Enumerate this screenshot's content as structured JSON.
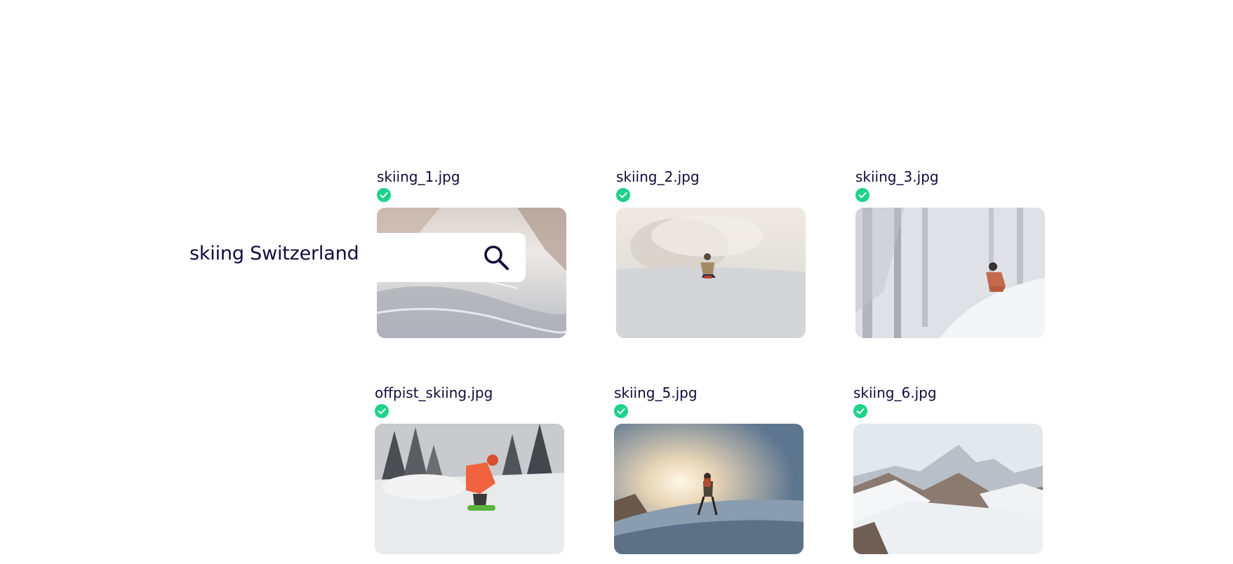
{
  "search": {
    "query": "skiing Switzerland",
    "icon": "search-icon"
  },
  "colors": {
    "text": "#0f0c3a",
    "check": "#1ed28a",
    "background": "#ffffff"
  },
  "results": [
    {
      "filename": "skiing_1.jpg",
      "status_icon": "check-circle-icon",
      "scene": "snowy slope with rocks"
    },
    {
      "filename": "skiing_2.jpg",
      "status_icon": "check-circle-icon",
      "scene": "snowboarder in powder cloud"
    },
    {
      "filename": "skiing_3.jpg",
      "status_icon": "check-circle-icon",
      "scene": "skier in snowy forest"
    },
    {
      "filename": "offpist_skiing.jpg",
      "status_icon": "check-circle-icon",
      "scene": "snowboarder in orange jacket among pines"
    },
    {
      "filename": "skiing_5.jpg",
      "status_icon": "check-circle-icon",
      "scene": "ski tourer walking into the sun"
    },
    {
      "filename": "skiing_6.jpg",
      "status_icon": "check-circle-icon",
      "scene": "alpine glacier panorama"
    }
  ]
}
